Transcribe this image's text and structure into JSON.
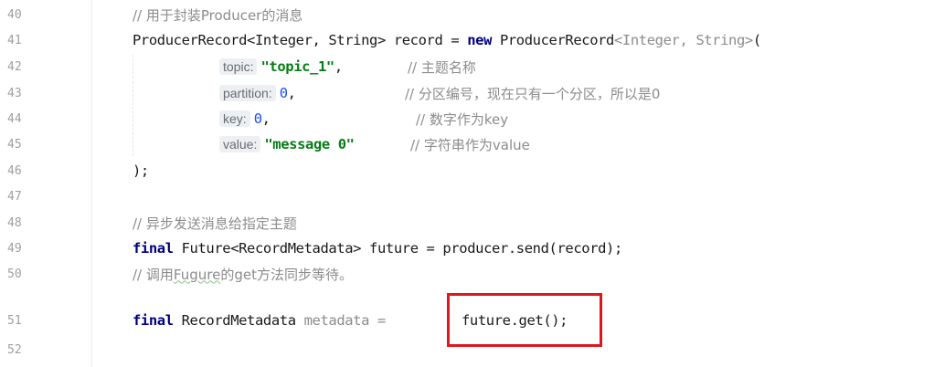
{
  "lines": [
    {
      "n": "40",
      "comment": "// 用于封装Producer的消息"
    },
    {
      "n": "41",
      "cls1": "ProducerRecord",
      "gen1": "<Integer, String>",
      "var": " record = ",
      "kw": "new",
      "cls2": " ProducerRecord",
      "gen2": "<Integer, String>",
      "tail": "("
    },
    {
      "n": "42",
      "hint": "topic:",
      "value": "\"topic_1\"",
      "punct": ",",
      "comment": "// 主题名称"
    },
    {
      "n": "43",
      "hint": "partition:",
      "value": "0",
      "punct": ",",
      "comment": "// 分区编号，现在只有一个分区，所以是0"
    },
    {
      "n": "44",
      "hint": "key:",
      "value": "0",
      "punct": ",",
      "comment": "// 数字作为key"
    },
    {
      "n": "45",
      "hint": "value:",
      "value": "\"message 0\"",
      "punct": "",
      "comment": "// 字符串作为value"
    },
    {
      "n": "46",
      "text": ");"
    },
    {
      "n": "47"
    },
    {
      "n": "48",
      "comment": "// 异步发送消息给指定主题"
    },
    {
      "n": "49",
      "kw": "final",
      "text": " Future<RecordMetadata> future = producer.send(record);"
    },
    {
      "n": "50",
      "comment_pre": "// 调用",
      "comment_sq": "Fugure",
      "comment_post": "的get方法同步等待。"
    },
    {
      "n": "51",
      "kw": "final",
      "cls": " RecordMetadata ",
      "var": "metadata",
      "eq": " = ",
      "call": "future.get();"
    },
    {
      "n": "52"
    }
  ]
}
